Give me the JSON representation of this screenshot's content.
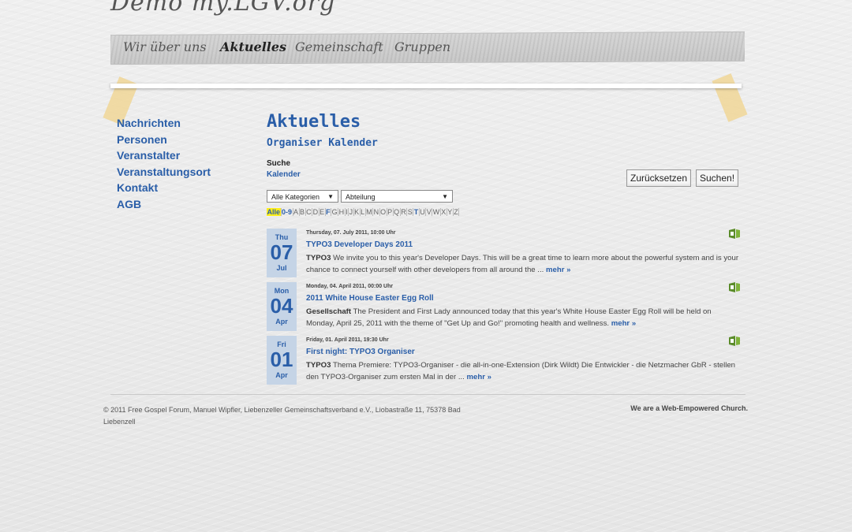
{
  "site": {
    "title": "Demo my.LGV.org"
  },
  "nav": {
    "items": [
      "Wir über uns",
      "Aktuelles",
      "Gemeinschaft",
      "Gruppen"
    ]
  },
  "sidebar": {
    "items": [
      "Nachrichten",
      "Personen",
      "Veranstalter",
      "Veranstaltungsort",
      "Kontakt",
      "AGB"
    ]
  },
  "main": {
    "title": "Aktuelles",
    "subtitle": "Organiser Kalender",
    "search_label": "Suche",
    "calendar_link": "Kalender",
    "reset_button": "Zurücksetzen",
    "search_button": "Suchen!",
    "category_select": "Alle Kategorien",
    "department_select": "Abteilung",
    "alphabet": [
      "Alle",
      "0-9",
      "A",
      "B",
      "C",
      "D",
      "E",
      "F",
      "G",
      "H",
      "I",
      "J",
      "K",
      "L",
      "M",
      "N",
      "O",
      "P",
      "Q",
      "R",
      "S",
      "T",
      "U",
      "V",
      "W",
      "X",
      "Y",
      "Z"
    ]
  },
  "events": [
    {
      "dow": "Thu",
      "day": "07",
      "month": "Jul",
      "datetime": "Thursday, 07. July 2011, 10:00 Uhr",
      "title": "TYPO3 Developer Days 2011",
      "category": "TYPO3",
      "text": "We invite you to this year's Developer Days. This will be a great time to learn more about the powerful system and is your chance to connect yourself with other developers from all around the ...",
      "more": "mehr »"
    },
    {
      "dow": "Mon",
      "day": "04",
      "month": "Apr",
      "datetime": "Monday, 04. April 2011, 00:00 Uhr",
      "title": "2011 White House Easter Egg Roll",
      "category": "Gesellschaft",
      "text": "The President and First Lady announced today that this year's White House Easter Egg Roll will be held on Monday, April 25, 2011 with the theme of \"Get Up and Go!\" promoting health and wellness.",
      "more": "mehr »"
    },
    {
      "dow": "Fri",
      "day": "01",
      "month": "Apr",
      "datetime": "Friday, 01. April 2011, 19:30 Uhr",
      "title": "First night: TYPO3 Organiser",
      "category": "TYPO3",
      "text": "Thema Premiere: TYPO3-Organiser - die all-in-one-Extension (Dirk Wildt) Die Entwickler -  die Netzmacher GbR - stellen den TYPO3-Organiser zum ersten Mal in der ...",
      "more": "mehr »"
    }
  ],
  "footer": {
    "copyright": "© 2011 Free Gospel Forum, Manuel Wipfler, Liebenzeller Gemeinschaftsverband e.V., Liobastraße 11, 75378 Bad Liebenzell",
    "tagline": "We are a Web-Empowered Church."
  },
  "colors": {
    "link": "#2a5ea8",
    "highlight": "#ffef1a",
    "datebox": "#c5d4e6"
  }
}
